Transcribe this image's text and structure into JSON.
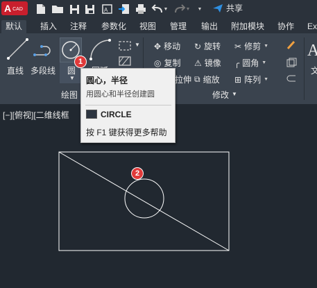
{
  "app": {
    "logo_letter": "A",
    "logo_sub": "CAD"
  },
  "quick_access": {
    "share_label": "共享"
  },
  "tabs": [
    {
      "label": "默认",
      "active": true
    },
    {
      "label": "插入"
    },
    {
      "label": "注释"
    },
    {
      "label": "参数化"
    },
    {
      "label": "视图"
    },
    {
      "label": "管理"
    },
    {
      "label": "输出"
    },
    {
      "label": "附加模块"
    },
    {
      "label": "协作"
    },
    {
      "label": "Ex"
    }
  ],
  "ribbon": {
    "draw": {
      "line": "直线",
      "polyline": "多段线",
      "circle": "圆",
      "arc": "圆弧",
      "panel_title": "绘图"
    },
    "modify": {
      "move": "移动",
      "rotate": "旋转",
      "trim": "修剪",
      "copy": "复制",
      "mirror": "镜像",
      "fillet": "圆角",
      "stretch": "拉伸",
      "scale": "缩放",
      "array": "阵列",
      "panel_title": "修改"
    },
    "text_fragment": "文"
  },
  "viewport": {
    "label": "[−][俯视][二维线框"
  },
  "tooltip": {
    "title": "圆心，半径",
    "description": "用圆心和半径创建圆",
    "command": "CIRCLE",
    "help": "按 F1 键获得更多帮助"
  },
  "badges": {
    "badge1": "1",
    "badge2": "2"
  },
  "colors": {
    "accent": "#c81f2d",
    "badge": "#e03a3a",
    "canvas_bg": "#212830",
    "ribbon_bg": "#3a434e"
  }
}
